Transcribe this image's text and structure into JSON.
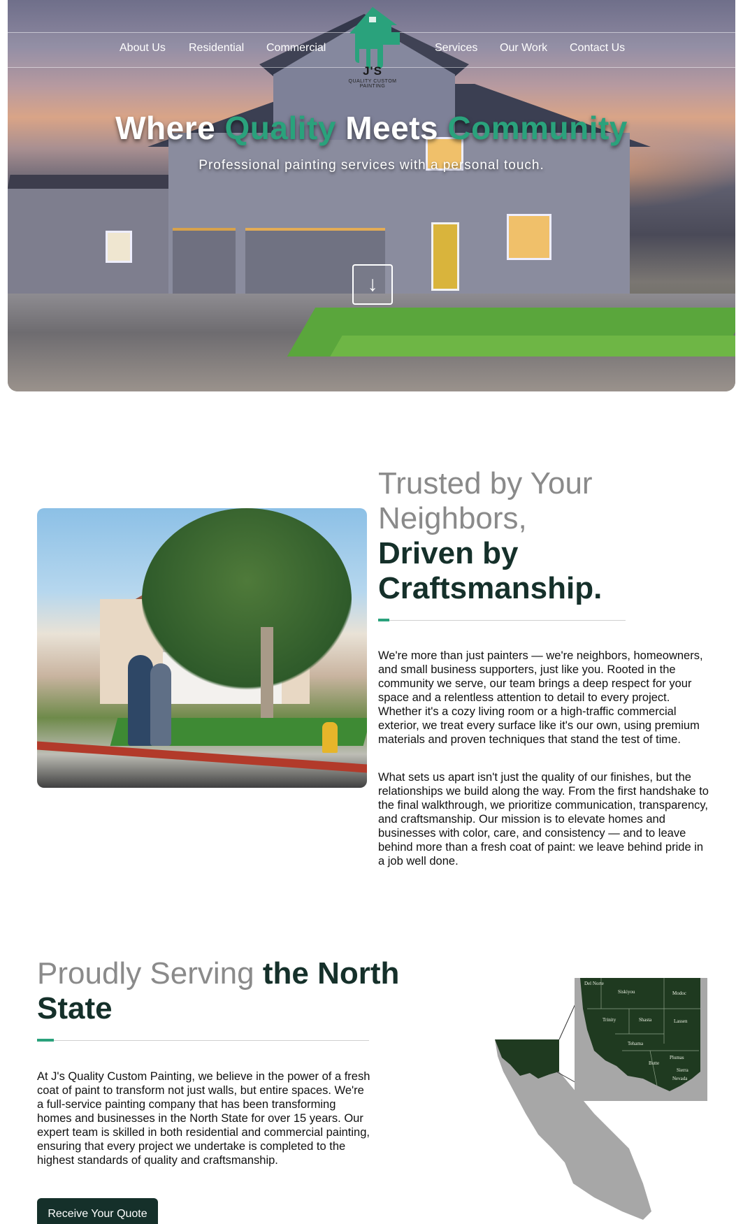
{
  "nav": {
    "left_links": [
      "About Us",
      "Residential",
      "Commercial"
    ],
    "right_links": [
      "Services",
      "Our Work",
      "Contact Us"
    ]
  },
  "logo": {
    "name": "J'S",
    "subtitle_line1": "QUALITY CUSTOM",
    "subtitle_line2": "PAINTING"
  },
  "hero": {
    "title_word1": "Where",
    "title_word2": "Quality",
    "title_word3": "Meets",
    "title_word4": "Community",
    "subtitle": "Professional painting services with a personal touch.",
    "scroll_icon": "arrow-down-icon",
    "scroll_glyph": "↓"
  },
  "about": {
    "title_light": "Trusted by Your Neighbors,",
    "title_dark": "Driven by Craftsmanship.",
    "paragraph1": "We're more than just painters — we're neighbors, homeowners, and small business supporters, just like you. Rooted in the community we serve, our team brings a deep respect for your space and a relentless attention to detail to every project. Whether it's a cozy living room or a high-traffic commercial exterior, we treat every surface like it's our own, using premium materials and proven techniques that stand the test of time.",
    "paragraph2": "What sets us apart isn't just the quality of our finishes, but the relationships we build along the way. From the first handshake to the final walkthrough, we prioritize communication, transparency, and craftsmanship. Our mission is to elevate homes and businesses with color, care, and consistency — and to leave behind more than a fresh coat of paint: we leave behind pride in a job well done."
  },
  "serving": {
    "title_light": "Proudly Serving",
    "title_dark": "the North State",
    "paragraph": "At J's Quality Custom Painting, we believe in the power of a fresh coat of paint to transform not just walls, but entire spaces. We're a full-service painting company that has been transforming homes and businesses in the North State for over 15 years. Our expert team is skilled in both residential and commercial painting, ensuring that every project we undertake is completed to the highest standards of quality and craftsmanship.",
    "button": "Receive Your Quote",
    "map_counties": [
      "Del Norte",
      "Siskiyou",
      "Modoc",
      "Trinity",
      "Shasta",
      "Lassen",
      "Tehama",
      "Plumas",
      "Butte",
      "Sierra",
      "Nevada"
    ]
  },
  "colors": {
    "accent": "#2aa27c",
    "dark_green": "#15302a",
    "map_fill": "#1f3a20",
    "map_state": "#a7a7a7",
    "heading_gray": "#8a8a8a"
  }
}
